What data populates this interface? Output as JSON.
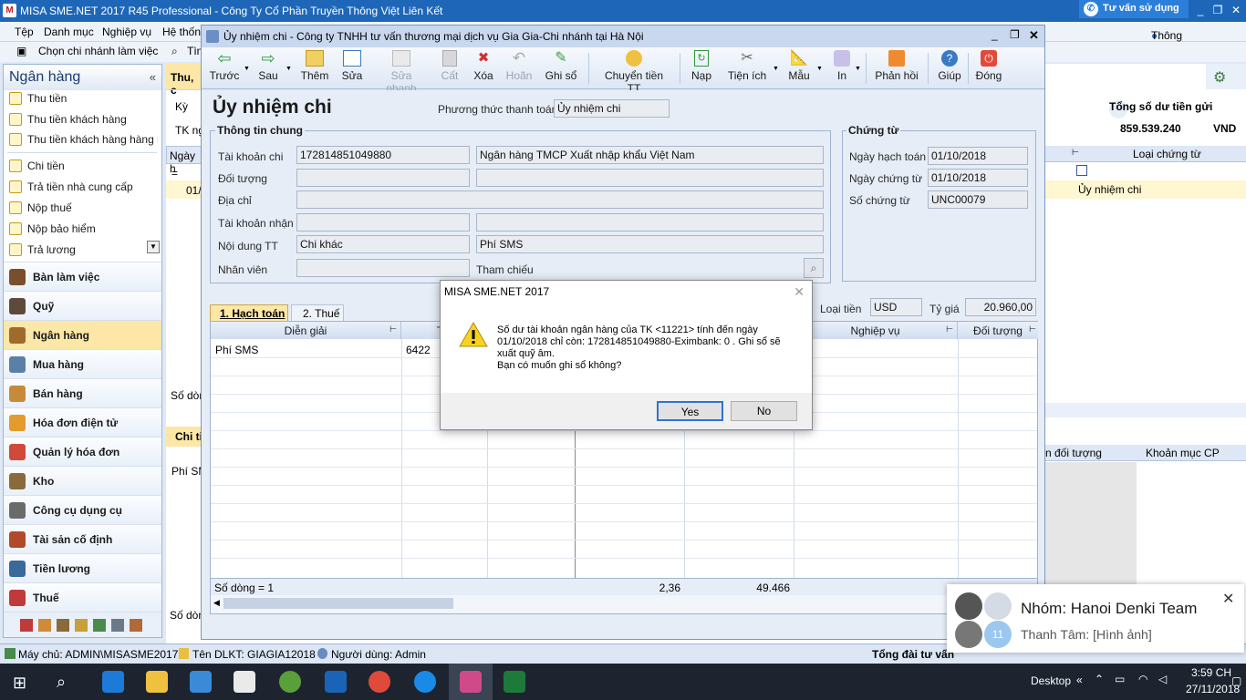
{
  "app": {
    "title": "MISA SME.NET 2017 R45 Professional - Công Ty Cổ Phần Truyền Thông Việt Liên Kết",
    "logo": "M",
    "consult": "Tư vấn sử dụng",
    "min": "_",
    "restore": "❐",
    "close": "✕"
  },
  "menu": {
    "items": [
      "Tệp",
      "Danh mục",
      "Nghiệp vụ",
      "Hệ thốn"
    ],
    "notice": "Thông báo",
    "branch": "Chọn chi nhánh làm việc",
    "search": "Tìm"
  },
  "nav": {
    "title": "Ngân hàng",
    "collapse": "«",
    "sub_items": [
      "Thu tiền",
      "Thu tiền khách hàng",
      "Thu tiền khách hàng hàng l...",
      "Chi tiền",
      "Trả tiền nhà cung cấp",
      "Nộp thuế",
      "Nộp bảo hiểm",
      "Trả lương"
    ],
    "modules": [
      "Bàn làm việc",
      "Quỹ",
      "Ngân hàng",
      "Mua hàng",
      "Bán hàng",
      "Hóa đơn điện tử",
      "Quản lý hóa đơn",
      "Kho",
      "Công cụ dụng cụ",
      "Tài sản cố định",
      "Tiền lương",
      "Thuế"
    ],
    "selected_module": "Ngân hàng"
  },
  "bg": {
    "tab": "Thu, c",
    "ky": "Kỳ",
    "tk": "TK ng",
    "ngay": "Ngày h",
    "row_date": "01/",
    "total_label": "Tổng số dư tiền gửi",
    "total_value": "859.539.240",
    "currency": "VND",
    "col_loai": "Loại chứng từ",
    "row_loai": "Ủy nhiệm chi",
    "so_dong": "Số dòn",
    "chi_tiet": "Chi ti",
    "phi": "Phí SM",
    "col_doi_tuong": "n đối tượng",
    "col_khoan_muc": "Khoản mục CP",
    "so_dong2": "Số dòn"
  },
  "window": {
    "title": "Ủy nhiệm chi - Công ty TNHH tư vấn thương mại dịch vụ Gia Gia-Chi nhánh tại Hà Nội",
    "toolbar": [
      "Trước",
      "Sau",
      "Thêm",
      "Sửa",
      "Sửa nhanh",
      "Cất",
      "Hoãn",
      "Xóa",
      "Ghi sổ",
      "Chuyển tiền TT",
      "Nạp",
      "Tiện ích",
      "Mẫu",
      "In",
      "Phản hồi",
      "Giúp",
      "Đóng"
    ],
    "heading": "Ủy nhiệm chi",
    "payment_method_label": "Phương thức thanh toán",
    "payment_method": "Ủy nhiệm chi",
    "general_title": "Thông tin chung",
    "fields": {
      "tai_khoan_chi_label": "Tài khoản chi",
      "tai_khoan_chi": "172814851049880",
      "bank_name": "Ngân hàng TMCP Xuất nhập khẩu Việt Nam",
      "doi_tuong_label": "Đối tượng",
      "dia_chi_label": "Địa chỉ",
      "tai_khoan_nhan_label": "Tài khoản nhận",
      "noi_dung_label": "Nội dung TT",
      "noi_dung": "Chi khác",
      "noi_dung_detail": "Phí SMS",
      "nhan_vien_label": "Nhân viên",
      "tham_chieu_label": "Tham chiếu"
    },
    "voucher": {
      "title": "Chứng từ",
      "ngay_hach_toan_label": "Ngày hạch toán",
      "ngay_hach_toan": "01/10/2018",
      "ngay_chung_tu_label": "Ngày chứng từ",
      "ngay_chung_tu": "01/10/2018",
      "so_chung_tu_label": "Số chứng từ",
      "so_chung_tu": "UNC00079"
    },
    "currency": {
      "loai_tien_label": "Loại tiền",
      "loai_tien": "USD",
      "ty_gia_label": "Tỷ giá",
      "ty_gia": "20.960,00"
    },
    "tabs": [
      "1. Hạch toán",
      "2. Thuế"
    ],
    "grid": {
      "headers": [
        "Diễn giải",
        "TK",
        "Nghiệp vụ",
        "Đối tượng"
      ],
      "row": {
        "dien_giai": "Phí SMS",
        "tk": "6422"
      },
      "footer_count": "Số dòng = 1",
      "footer_amount1": "2,36",
      "footer_amount2": "49.466"
    }
  },
  "msgbox": {
    "title": "MISA SME.NET 2017",
    "message": "Số dư tài khoản ngân hàng của TK <11221> tính đến ngày 01/10/2018 chỉ còn: 172814851049880-Eximbank: 0 . Ghi sổ sẽ xuất quỹ âm.",
    "question": "Bạn có muốn ghi sổ không?",
    "yes": "Yes",
    "no": "No"
  },
  "toast": {
    "group": "Nhóm: Hanoi Denki Team",
    "message": "Thanh Tâm: [Hình ảnh]",
    "count": "11"
  },
  "statusbar": {
    "server": "Máy chủ: ADMIN\\MISASME2017",
    "db": "Tên DLKT: GIAGIA12018",
    "user": "Người dùng: Admin",
    "hotline": "Tổng đài tư vấn"
  },
  "taskbar": {
    "desktop": "Desktop",
    "time": "3:59 CH",
    "date": "27/11/2018"
  }
}
